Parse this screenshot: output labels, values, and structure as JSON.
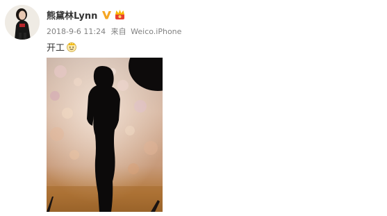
{
  "user": {
    "name": "熊黛林Lynn",
    "avatar_icon": "avatar-photo",
    "verified_icon": "verified-v-badge-icon",
    "member_icon": "crown-member-icon",
    "verified_color": "#f5a623"
  },
  "post": {
    "timestamp": "2018-9-6 11:24",
    "source_prefix": "来自",
    "source_client": "Weico.iPhone",
    "text": "开工",
    "emoji_icon": "crown-emoji-icon",
    "image_icon": "silhouette-photo"
  },
  "colors": {
    "text_main": "#333333",
    "text_meta": "#808080",
    "background": "#ffffff"
  }
}
